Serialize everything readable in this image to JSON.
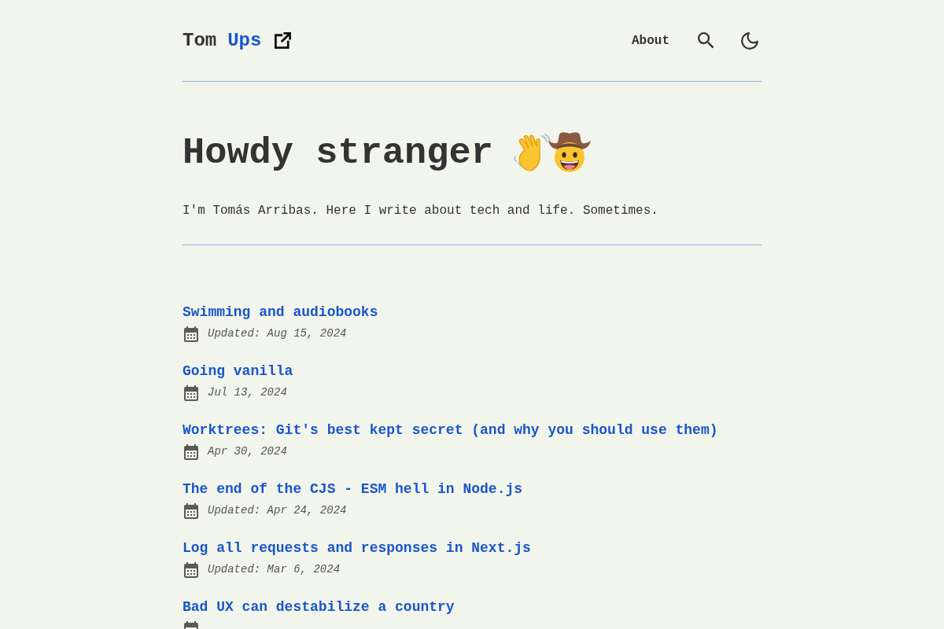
{
  "header": {
    "logo": {
      "text": "Tom",
      "accent": "Ups"
    },
    "about": "About"
  },
  "hero": {
    "title": "Howdy stranger",
    "intro": "I'm Tomás Arribas. Here I write about tech and life. Sometimes."
  },
  "posts": [
    {
      "title": "Swimming and audiobooks",
      "date": "Updated: Aug 15, 2024"
    },
    {
      "title": "Going vanilla",
      "date": "Jul 13, 2024"
    },
    {
      "title": "Worktrees: Git's best kept secret (and why you should use them)",
      "date": "Apr 30, 2024"
    },
    {
      "title": "The end of the CJS - ESM hell in Node.js",
      "date": "Updated: Apr 24, 2024"
    },
    {
      "title": "Log all requests and responses in Next.js",
      "date": "Updated: Mar 6, 2024"
    },
    {
      "title": "Bad UX can destabilize a country"
    }
  ]
}
